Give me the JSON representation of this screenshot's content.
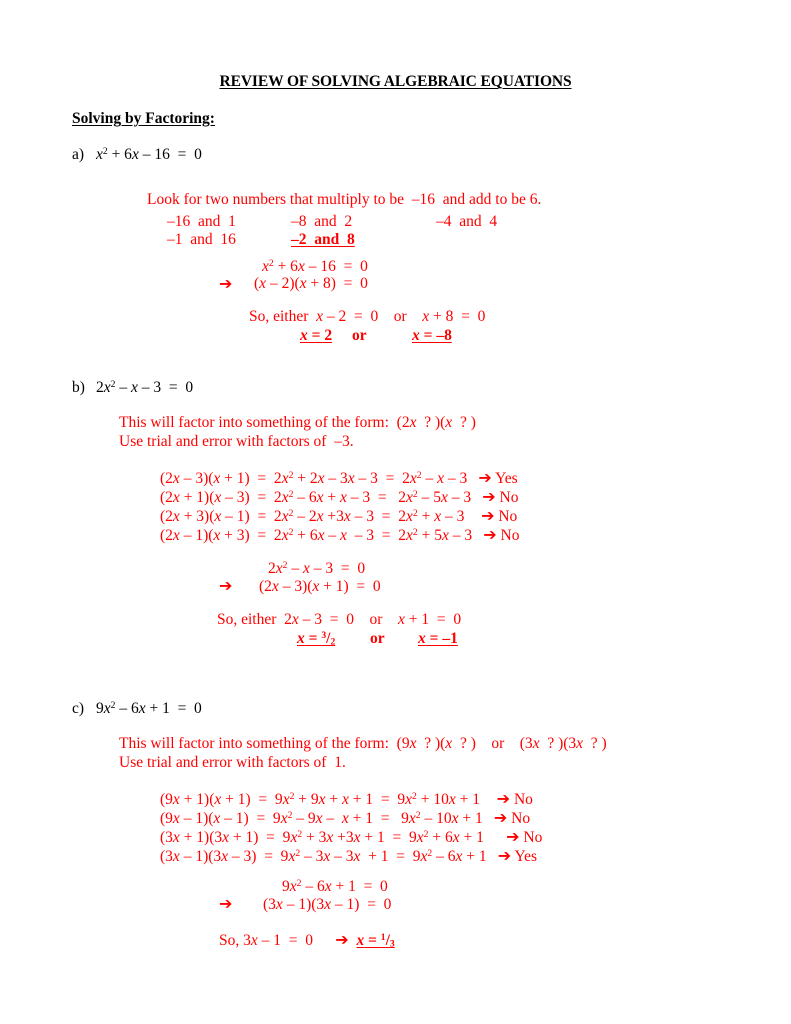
{
  "document": {
    "title": "REVIEW OF SOLVING ALGEBRAIC EQUATIONS",
    "section_heading": "Solving by Factoring:"
  },
  "colors": {
    "ink": "#000000",
    "annotation_red": "#FF0000",
    "page_background": "#FFFFFF"
  },
  "glyphs": {
    "arrow": "➔"
  },
  "problems": {
    "a": {
      "label": "a)",
      "equation": "x² + 6x – 16  =  0",
      "hint": "Look for two numbers that multiply to be  –16  and add to be 6.",
      "pairs": {
        "row1": [
          "–16  and  1",
          "–8  and  2",
          "–4  and  4"
        ],
        "row2": [
          "–1  and  16",
          "–2  and  8",
          ""
        ]
      },
      "pair_chosen": "–2  and  8",
      "work": {
        "line1": "x² + 6x – 16  =  0",
        "line2": "(x – 2)(x + 8)  =  0"
      },
      "either_prefix": "So, either",
      "either_left": "x – 2  =  0",
      "either_or": "or",
      "either_right": "x + 8  =  0",
      "answer_left": "x = 2",
      "answer_or": "or",
      "answer_right": "x = –8"
    },
    "b": {
      "label": "b)",
      "equation": "2x² – x – 3  =  0",
      "form_text": "This will factor into something of the form:  (2x  ? )(x  ? )",
      "trial_text": "Use trial and error with factors of  –3.",
      "trials": [
        {
          "expression": "(2x – 3)(x + 1)  =  2x² + 2x – 3x – 3  =  2x² – x – 3",
          "verdict": "Yes"
        },
        {
          "expression": "(2x + 1)(x – 3)  =  2x² – 6x + x – 3  =   2x² – 5x – 3",
          "verdict": "No"
        },
        {
          "expression": "(2x + 3)(x – 1)  =  2x² – 2x +3x – 3  =  2x² + x – 3",
          "verdict": "No"
        },
        {
          "expression": "(2x – 1)(x + 3)  =  2x² + 6x – x  – 3  =  2x² + 5x – 3",
          "verdict": "No"
        }
      ],
      "work": {
        "line1": "2x² – x – 3  =  0",
        "line2": "(2x – 3)(x + 1)  =  0"
      },
      "either_prefix": "So, either",
      "either_left": "2x – 3  =  0",
      "either_or": "or",
      "either_right": "x + 1  =  0",
      "answer_left": "x = ³/₂",
      "answer_or": "or",
      "answer_right": "x = –1"
    },
    "c": {
      "label": "c)",
      "equation": "9x² – 6x + 1  =  0",
      "form_text": "This will factor into something of the form:  (9x  ? )(x  ? )    or    (3x  ? )(3x  ? )",
      "trial_text": "Use trial and error with factors of  1.",
      "trials": [
        {
          "expression": "(9x + 1)(x + 1)  =  9x² + 9x + x + 1  =  9x² + 10x + 1",
          "verdict": "No"
        },
        {
          "expression": "(9x – 1)(x – 1)  =  9x² – 9x –  x + 1  =   9x² – 10x + 1",
          "verdict": "No"
        },
        {
          "expression": "(3x + 1)(3x + 1)  =  9x² + 3x +3x + 1  =  9x² + 6x + 1",
          "verdict": "No"
        },
        {
          "expression": "(3x – 1)(3x – 3)  =  9x² – 3x – 3x  + 1  =  9x² – 6x + 1",
          "verdict": "Yes"
        }
      ],
      "work": {
        "line1": "9x² – 6x + 1  =  0",
        "line2": "(3x – 1)(3x – 1)  =  0"
      },
      "final_prefix": "So, 3x – 1  =  0",
      "final_answer": "x = ¹/₃"
    }
  }
}
